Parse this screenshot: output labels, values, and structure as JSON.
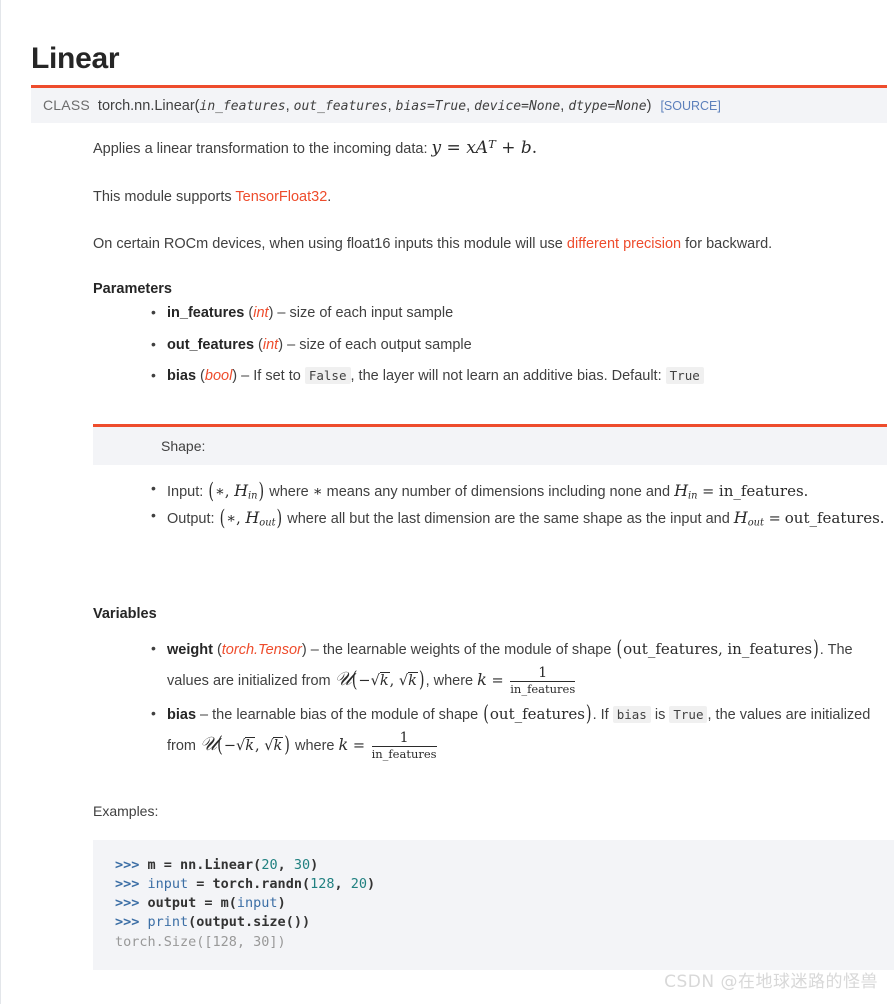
{
  "page": {
    "title": "Linear",
    "watermark": "CSDN @在地球迷路的怪兽"
  },
  "signature": {
    "class_keyword": "CLASS",
    "qualified_name": "torch.nn.Linear",
    "open_paren": "(",
    "close_paren": ")",
    "params": [
      "in_features",
      "out_features",
      "bias=True",
      "device=None",
      "dtype=None"
    ],
    "separator": ", ",
    "source_link": "[SOURCE]",
    "accent_color": "#ee4c2c",
    "background_color": "#f3f4f7",
    "link_color": "#5b7fbb"
  },
  "description": {
    "line1_prefix": "Applies a linear transformation to the incoming data: ",
    "line1_formula_text": "y = xA^T + b.",
    "line2_prefix": "This module supports ",
    "line2_link": "TensorFloat32",
    "line2_suffix": ".",
    "line3_prefix": "On certain ROCm devices, when using float16 inputs this module will use ",
    "line3_link": "different precision",
    "line3_suffix": " for backward."
  },
  "parameters": {
    "heading": "Parameters",
    "items": [
      {
        "name": "in_features",
        "type": "int",
        "dash": " – ",
        "desc": "size of each input sample"
      },
      {
        "name": "out_features",
        "type": "int",
        "dash": " – ",
        "desc": "size of each output sample"
      },
      {
        "name": "bias",
        "type": "bool",
        "dash": " – ",
        "desc_part1": "If set to ",
        "literal_false": "False",
        "desc_part2": ", the layer will not learn an additive bias. Default: ",
        "literal_true": "True"
      }
    ]
  },
  "shape": {
    "heading": "Shape:",
    "input_label": "Input: ",
    "input_text": "(*, H_in) where * means any number of dimensions including none and H_in = in_features.",
    "output_label": "Output: ",
    "output_text": "(*, H_out) where all but the last dimension are the same shape as the input and H_out = out_features."
  },
  "variables": {
    "heading": "Variables",
    "weight": {
      "name": "weight",
      "type": "torch.Tensor",
      "dash": " – ",
      "desc1": "the learnable weights of the module of shape ",
      "shape_text": "(out_features, in_features)",
      "desc2": ". The values are initialized from ",
      "dist_text": "U(-sqrt(k), sqrt(k))",
      "desc3": ", where ",
      "k_text": "k = 1 / in_features",
      "numerator": "1",
      "denominator": "in_features"
    },
    "bias": {
      "name": "bias",
      "dash": " – ",
      "desc1": "the learnable bias of the module of shape ",
      "shape_text": "(out_features)",
      "desc2": ". If ",
      "literal_bias": "bias",
      "desc3": " is ",
      "literal_true": "True",
      "desc4": ", the values are initialized from ",
      "dist_text": "U(-sqrt(k), sqrt(k))",
      "desc5": " where ",
      "k_text": "k = 1 / in_features",
      "numerator": "1",
      "denominator": "in_features"
    }
  },
  "examples": {
    "label": "Examples:",
    "prompt": ">>> ",
    "lines": [
      {
        "type": "input",
        "text": "m = nn.Linear(20, 30)"
      },
      {
        "type": "input",
        "text": "input = torch.randn(128, 20)"
      },
      {
        "type": "input",
        "text": "output = m(input)"
      },
      {
        "type": "input",
        "text": "print(output.size())"
      },
      {
        "type": "output",
        "text": "torch.Size([128, 30])"
      }
    ]
  },
  "math_symbols": {
    "asterisk": "∗",
    "equals": "=",
    "minus": "−",
    "sqrt": "√",
    "H": "H",
    "k": "k",
    "y": "y",
    "x": "x",
    "A": "A",
    "T": "T",
    "plus": "+",
    "b": "b",
    "cal_U": "𝒰"
  }
}
